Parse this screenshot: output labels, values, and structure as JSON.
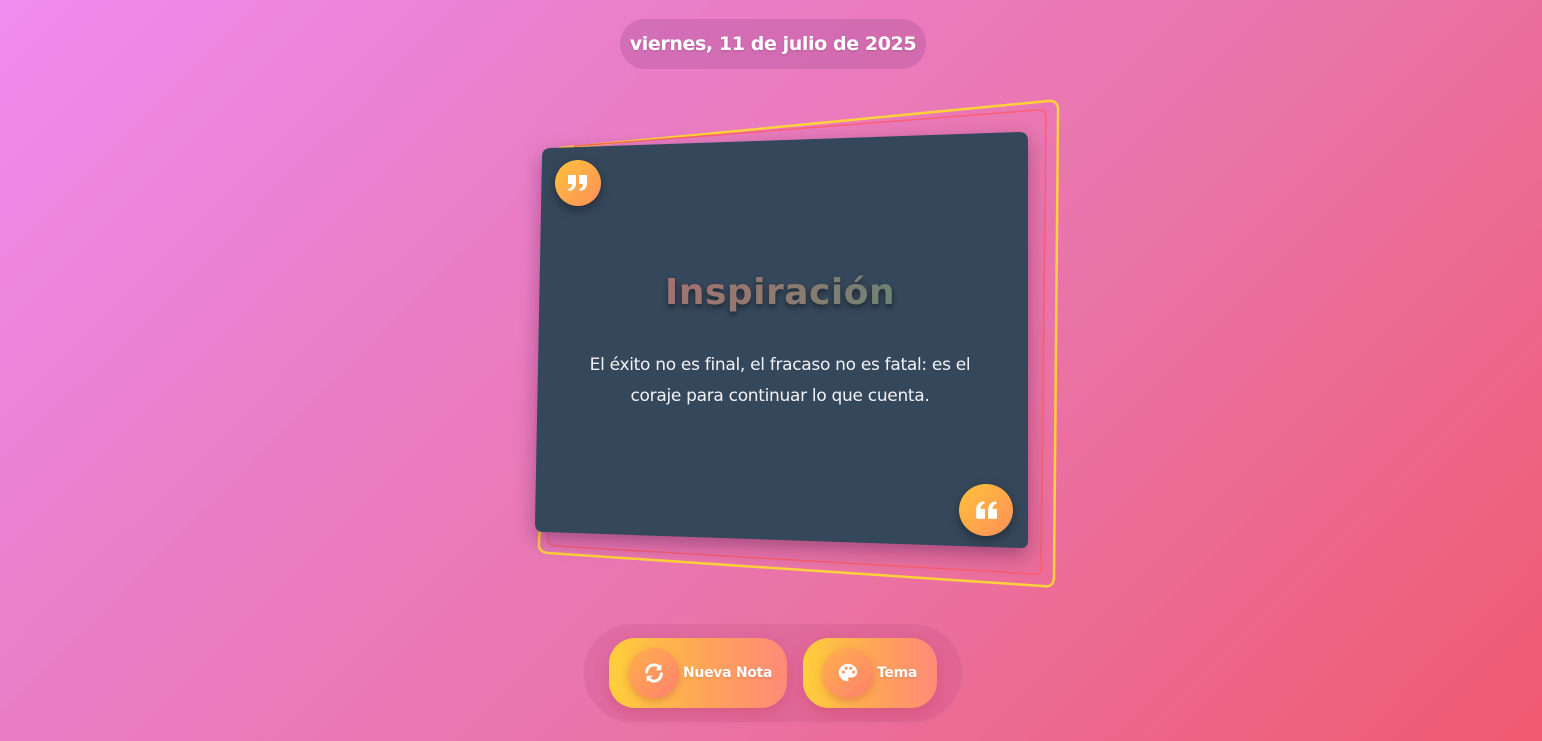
{
  "header": {
    "date": "viernes, 11 de julio de 2025"
  },
  "note": {
    "title": "Inspiración",
    "quote": "El éxito no es final, el fracaso no es fatal: es el coraje para continuar lo que cuenta.",
    "open_quote_icon": "quote-right-icon",
    "close_quote_icon": "quote-left-icon"
  },
  "toolbar": {
    "new_note_label": "Nueva Nota",
    "new_note_icon": "sync-icon",
    "theme_label": "Tema",
    "theme_icon": "palette-icon"
  },
  "colors": {
    "card": "#34475a",
    "frame_yellow": "#ffd23c",
    "frame_red": "#ff5a6a",
    "accent_orange": "#ff9a50"
  }
}
